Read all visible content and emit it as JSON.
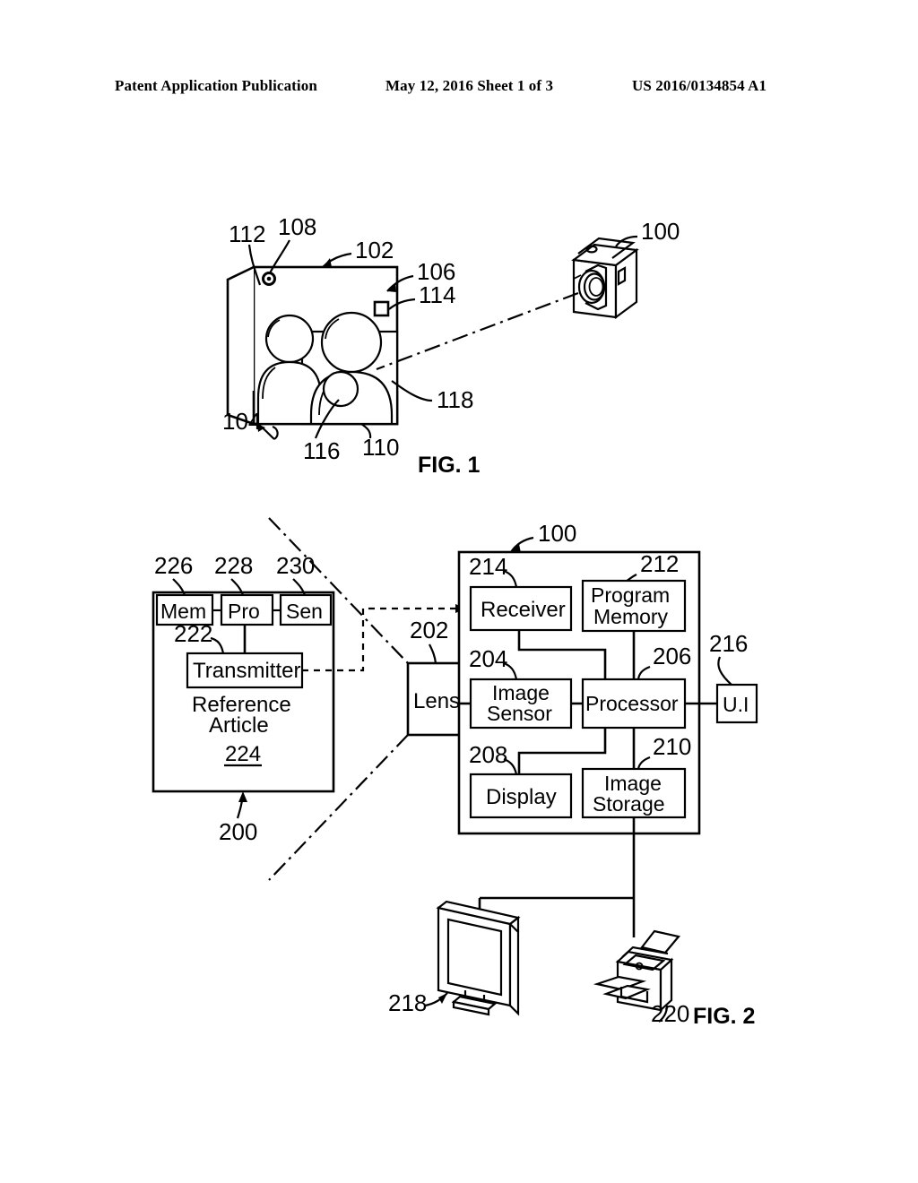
{
  "header": {
    "left": "Patent Application Publication",
    "middle": "May 12, 2016  Sheet 1 of 3",
    "right": "US 2016/0134854 A1"
  },
  "figures": [
    {
      "id": "fig1",
      "label": "FIG. 1",
      "caption_ref": "FIG. 1",
      "refs": {
        "r100": "100",
        "r102": "102",
        "r104": "104",
        "r106": "106",
        "r108": "108",
        "r110": "110",
        "r112": "112",
        "r114": "114",
        "r116": "116",
        "r118": "118"
      }
    },
    {
      "id": "fig2",
      "label": "FIG. 2",
      "caption_ref": "FIG. 2",
      "refs": {
        "r100": "100",
        "r200": "200",
        "r202": "202",
        "r204": "204",
        "r206": "206",
        "r208": "208",
        "r210": "210",
        "r212": "212",
        "r214": "214",
        "r216": "216",
        "r218": "218",
        "r220": "220",
        "r222": "222",
        "r224": "224",
        "r226": "226",
        "r228": "228",
        "r230": "230"
      },
      "blocks": {
        "mem": "Mem",
        "pro": "Pro",
        "sen": "Sen",
        "transmitter": "Transmitter",
        "reference_article_line1": "Reference",
        "reference_article_line2": "Article",
        "reference_article_num": "224",
        "lens": "Lens",
        "receiver": "Receiver",
        "program_memory_line1": "Program",
        "program_memory_line2": "Memory",
        "image_sensor_line1": "Image",
        "image_sensor_line2": "Sensor",
        "processor": "Processor",
        "ui": "U.I",
        "display": "Display",
        "image_storage_line1": "Image",
        "image_storage_line2": "Storage"
      }
    }
  ]
}
